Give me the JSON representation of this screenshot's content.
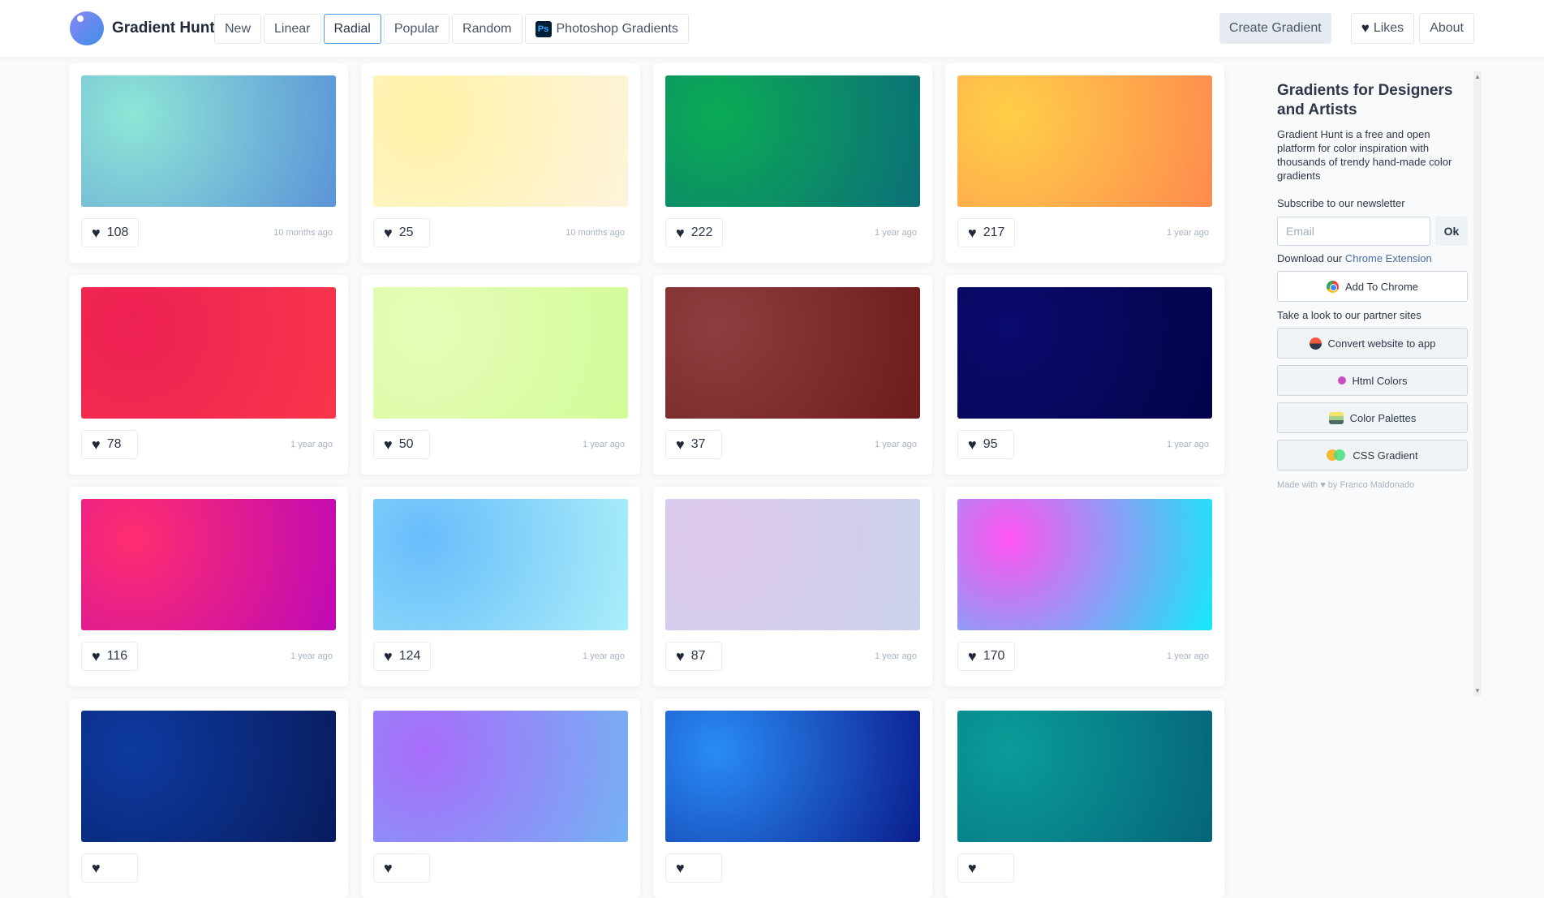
{
  "brand": {
    "name": "Gradient Hunt"
  },
  "nav": {
    "tabs": [
      {
        "label": "New"
      },
      {
        "label": "Linear"
      },
      {
        "label": "Radial",
        "active": true
      },
      {
        "label": "Popular"
      },
      {
        "label": "Random"
      },
      {
        "label": "Photoshop Gradients",
        "icon": "ps-icon",
        "icon_text": "Ps"
      }
    ]
  },
  "header_actions": {
    "create": "Create Gradient",
    "likes": "Likes",
    "about": "About"
  },
  "gradients": [
    {
      "likes": "108",
      "time": "10 months ago",
      "from": "#8ee6d6",
      "to": "#5b93d9"
    },
    {
      "likes": "25",
      "time": "10 months ago",
      "from": "#fff3a8",
      "to": "#fff3dc"
    },
    {
      "likes": "222",
      "time": "1 year ago",
      "from": "#0bab55",
      "to": "#0c6f78"
    },
    {
      "likes": "217",
      "time": "1 year ago",
      "from": "#ffcf48",
      "to": "#ff8a4f"
    },
    {
      "likes": "78",
      "time": "1 year ago",
      "from": "#ee2054",
      "to": "#f8364a"
    },
    {
      "likes": "50",
      "time": "1 year ago",
      "from": "#e6fdb9",
      "to": "#d2fb98"
    },
    {
      "likes": "37",
      "time": "1 year ago",
      "from": "#8e3e3e",
      "to": "#6e1b1b"
    },
    {
      "likes": "95",
      "time": "1 year ago",
      "from": "#0a0b6e",
      "to": "#04034a"
    },
    {
      "likes": "116",
      "time": "1 year ago",
      "from": "#ff2d6f",
      "to": "#bf09b6"
    },
    {
      "likes": "124",
      "time": "1 year ago",
      "from": "#68bdfb",
      "to": "#aaeefa"
    },
    {
      "likes": "87",
      "time": "1 year ago",
      "from": "#dec8ee",
      "to": "#cad2ec"
    },
    {
      "likes": "170",
      "time": "1 year ago",
      "from": "#ff55f0",
      "to": "#13e9fb"
    },
    {
      "likes": "",
      "time": "",
      "from": "#0d3aa0",
      "to": "#081c5e"
    },
    {
      "likes": "",
      "time": "",
      "from": "#a86cfb",
      "to": "#74b2f3"
    },
    {
      "likes": "",
      "time": "",
      "from": "#2a8cf6",
      "to": "#0a1d8c"
    },
    {
      "likes": "",
      "time": "",
      "from": "#0a9d98",
      "to": "#06647a"
    }
  ],
  "sidebar": {
    "title": "Gradients for Designers and Artists",
    "description": "Gradient Hunt is a free and open platform for color inspiration with thousands of trendy hand-made color gradients",
    "newsletter_label": "Subscribe to our newsletter",
    "email_placeholder": "Email",
    "ok": "Ok",
    "download_prefix": "Download our ",
    "download_link": "Chrome Extension",
    "add_chrome": "Add To Chrome",
    "partners_label": "Take a look to our partner sites",
    "partners": [
      {
        "label": "Convert website to app",
        "icon": "boat-icon"
      },
      {
        "label": "Html Colors",
        "icon": "dot-icon"
      },
      {
        "label": "Color Palettes",
        "icon": "palette-icon"
      },
      {
        "label": "CSS Gradient",
        "icon": "css-gradient-icon"
      }
    ],
    "credit_prefix": "Made with",
    "credit_suffix": "by Franco Maldonado"
  }
}
